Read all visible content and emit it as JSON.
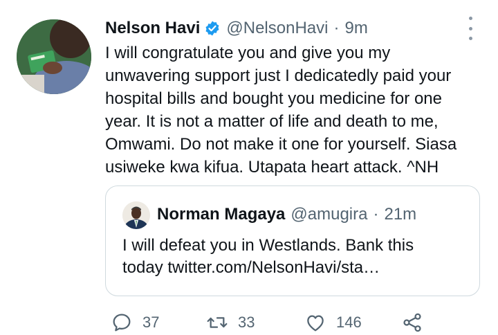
{
  "tweet": {
    "author_name": "Nelson Havi",
    "handle": "@NelsonHavi",
    "separator": "·",
    "time": "9m",
    "text_lines": [
      "I will congratulate you and give you my",
      "unwavering support just I dedicatedly paid your",
      "hospital bills and bought you medicine for one",
      "year. It is not a matter of life and death to me,",
      "Omwami. Do not make it one for yourself. Siasa",
      "usiweke kwa kifua. Utapata heart attack. ^NH"
    ],
    "avatar_icon": "profile-photo",
    "verified_icon": "verified-badge-icon",
    "verified_color": "#1d9bf0"
  },
  "quoted_tweet": {
    "author_name": "Norman Magaya",
    "handle": "@amugira",
    "separator": "·",
    "time": "21m",
    "text_lines": [
      "I will defeat you in Westlands. Bank this",
      "today twitter.com/NelsonHavi/sta…"
    ]
  },
  "actions": {
    "reply_count": "37",
    "retweet_count": "33",
    "like_count": "146",
    "icons": [
      "reply-icon",
      "retweet-icon",
      "like-icon",
      "share-icon"
    ]
  },
  "colors": {
    "text": "#0f1419",
    "secondary": "#536471",
    "border": "#cfd9de"
  }
}
